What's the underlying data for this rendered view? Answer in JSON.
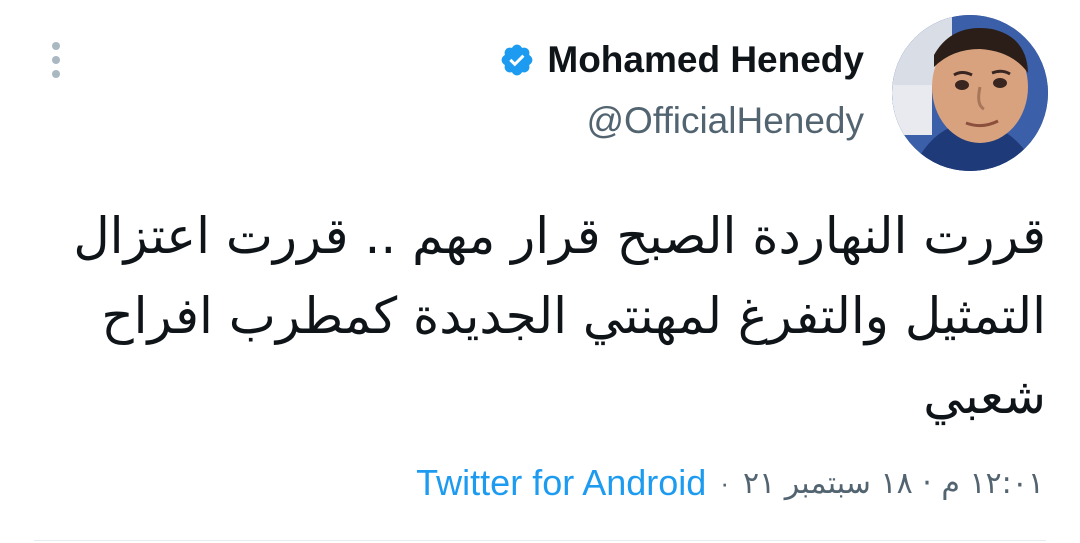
{
  "user": {
    "display_name": "Mohamed Henedy",
    "handle": "@OfficialHenedy",
    "verified": true,
    "verified_icon": "verified-badge-icon",
    "avatar": "profile-photo"
  },
  "tweet": {
    "text": "قررت النهاردة الصبح قرار مهم .. قررت اعتزال التمثيل والتفرغ لمهنتي الجديدة كمطرب افراح شعبي",
    "timestamp": "١٢:٠١ م · ١٨ سبتمبر ٢١",
    "separator": "·",
    "source": "Twitter for Android"
  },
  "menu": {
    "icon": "more-vertical-icon"
  },
  "colors": {
    "accent": "#1d9bf0",
    "secondary_text": "#536471",
    "primary_text": "#0f1419",
    "menu_dots": "#aab8c2"
  }
}
